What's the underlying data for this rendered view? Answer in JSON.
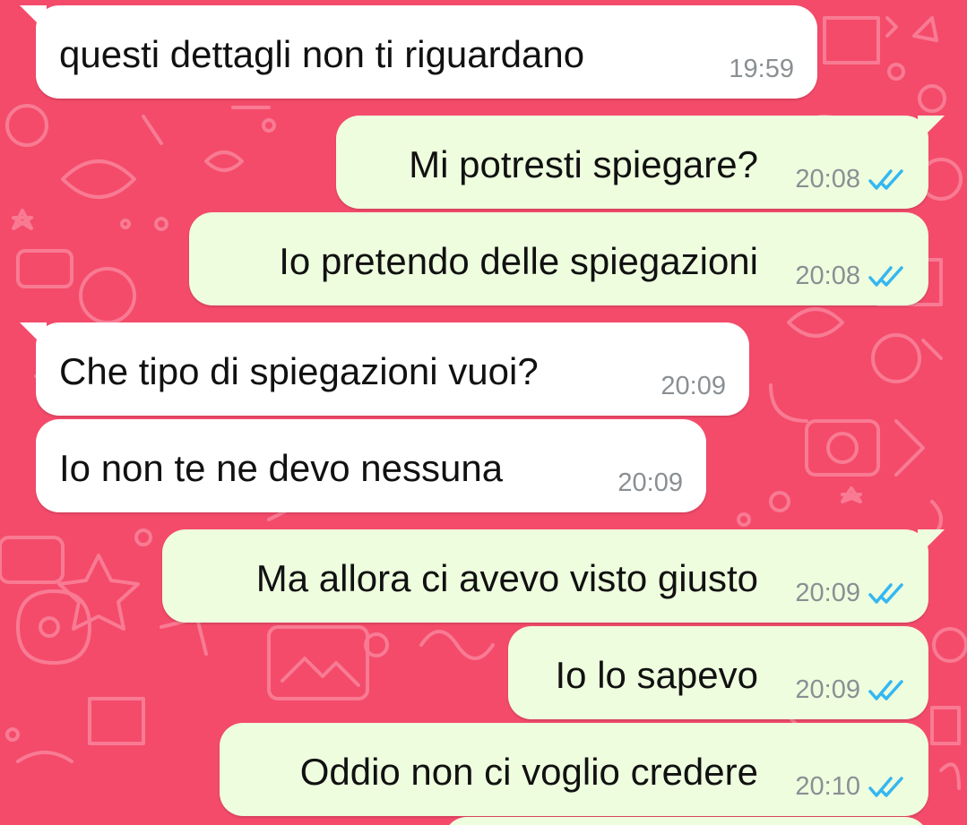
{
  "colors": {
    "wallpaper": "#f44b6b",
    "wallpaper_doodle": "#f87b93",
    "incoming_bubble": "#ffffff",
    "outgoing_bubble": "#eefdde",
    "message_text": "#111111",
    "timestamp": "#8a8f93",
    "read_ticks": "#34b7f1"
  },
  "messages": [
    {
      "direction": "incoming",
      "text": "questi dettagli non ti riguardano",
      "time": "19:59"
    },
    {
      "direction": "outgoing",
      "text": "Mi potresti spiegare?",
      "time": "20:08",
      "status_icon": "double-check-icon"
    },
    {
      "direction": "outgoing",
      "text": "Io pretendo delle spiegazioni",
      "time": "20:08",
      "status_icon": "double-check-icon"
    },
    {
      "direction": "incoming",
      "text": "Che tipo di spiegazioni vuoi?",
      "time": "20:09"
    },
    {
      "direction": "incoming",
      "text": "Io non te ne devo nessuna",
      "time": "20:09"
    },
    {
      "direction": "outgoing",
      "text": "Ma allora ci avevo visto giusto",
      "time": "20:09",
      "status_icon": "double-check-icon"
    },
    {
      "direction": "outgoing",
      "text": "Io lo sapevo",
      "time": "20:09",
      "status_icon": "double-check-icon"
    },
    {
      "direction": "outgoing",
      "text": "Oddio non ci voglio credere",
      "time": "20:10",
      "status_icon": "double-check-icon"
    }
  ]
}
